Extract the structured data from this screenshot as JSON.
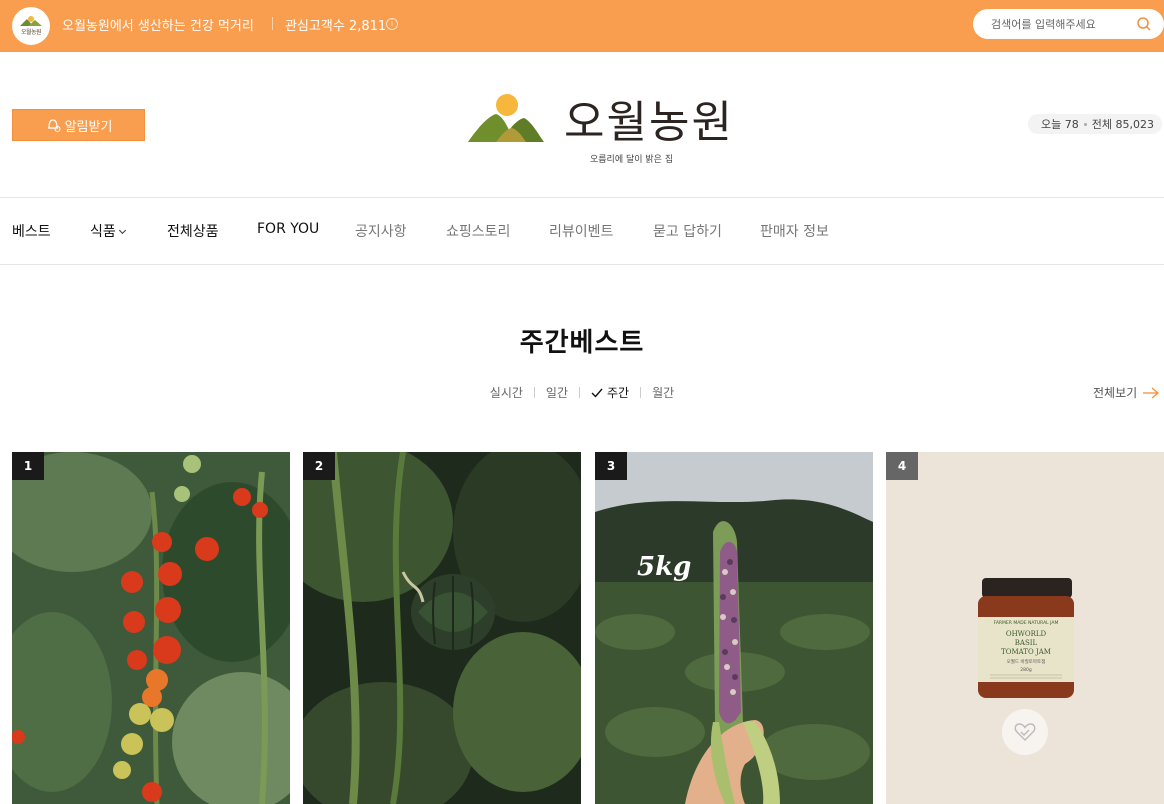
{
  "topbar": {
    "description": "오월농원에서 생산하는 건강 먹거리",
    "favorites": "관심고객수 2,811",
    "info_glyph": "i",
    "search_placeholder": "검색어를 입력해주세요",
    "store_logo_text": "오월농원",
    "bg_color": "#f99d4e"
  },
  "header": {
    "notify_label": "알림받기",
    "brand_name": "오월농원",
    "brand_sub": "오름리에 달이 밝은 집",
    "visit_today": "오늘 78",
    "visit_total": "전체 85,023"
  },
  "nav": {
    "items": [
      {
        "label": "베스트"
      },
      {
        "label": "식품"
      },
      {
        "label": "전체상품"
      },
      {
        "label": "FOR YOU"
      },
      {
        "label": "공지사항"
      },
      {
        "label": "쇼핑스토리"
      },
      {
        "label": "리뷰이벤트"
      },
      {
        "label": "묻고 답하기"
      },
      {
        "label": "판매자 정보"
      }
    ]
  },
  "section": {
    "title": "주간베스트",
    "tabs": [
      {
        "label": "실시간",
        "selected": false
      },
      {
        "label": "일간",
        "selected": false
      },
      {
        "label": "주간",
        "selected": true
      },
      {
        "label": "월간",
        "selected": false
      }
    ],
    "see_all": "전체보기"
  },
  "products": [
    {
      "rank": "1",
      "image": "cherry-tomato-vine-image"
    },
    {
      "rank": "2",
      "image": "squash-vine-image"
    },
    {
      "rank": "3",
      "image": "purple-corn-image",
      "overlay_text": "5kg"
    },
    {
      "rank": "4",
      "image": "basil-tomato-jam-jar-image",
      "jar_brand": "FARMER MADE NATURAL JAM",
      "jar_line1": "OHWORLD",
      "jar_line2": "BASIL",
      "jar_line3": "TOMATO JAM",
      "jar_korean": "오월드 바질토마토잼",
      "jar_weight": "280g"
    }
  ]
}
